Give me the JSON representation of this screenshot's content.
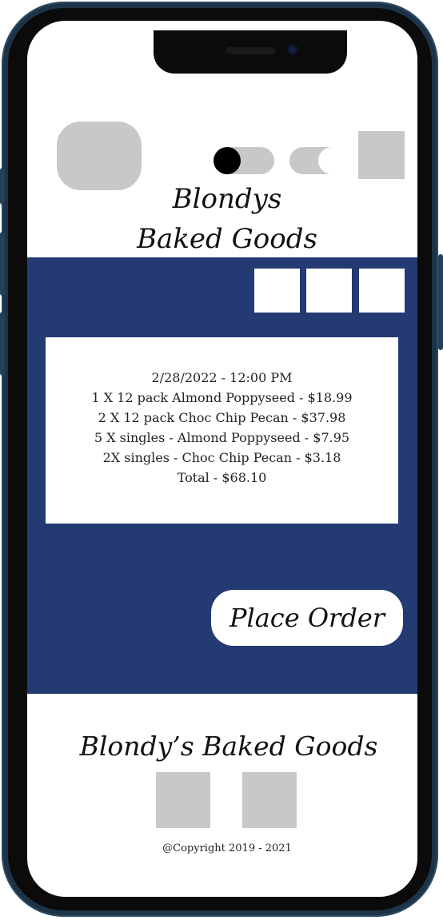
{
  "header": {
    "brand_line1": "Blondys",
    "brand_line2": "Baked Goods"
  },
  "order": {
    "date_time": "2/28/2022 - 12:00 PM",
    "items": [
      "1 X 12 pack Almond Poppyseed - $18.99",
      "2 X 12 pack  Choc Chip Pecan - $37.98",
      "5 X singles - Almond Poppyseed - $7.95",
      "2X singles - Choc Chip Pecan - $3.18"
    ],
    "total": "Total - $68.10"
  },
  "actions": {
    "place_order_label": "Place Order"
  },
  "footer": {
    "title": "Blondy’s Baked Goods",
    "copyright": "@Copyright 2019 - 2021"
  },
  "colors": {
    "band": "#233a72",
    "placeholder": "#c8c8c8",
    "frame": "#1d3347"
  },
  "icons": {
    "dark_toggle": "toggle-icon",
    "light_toggle": "toggle-icon",
    "logo": "image-placeholder-icon"
  }
}
